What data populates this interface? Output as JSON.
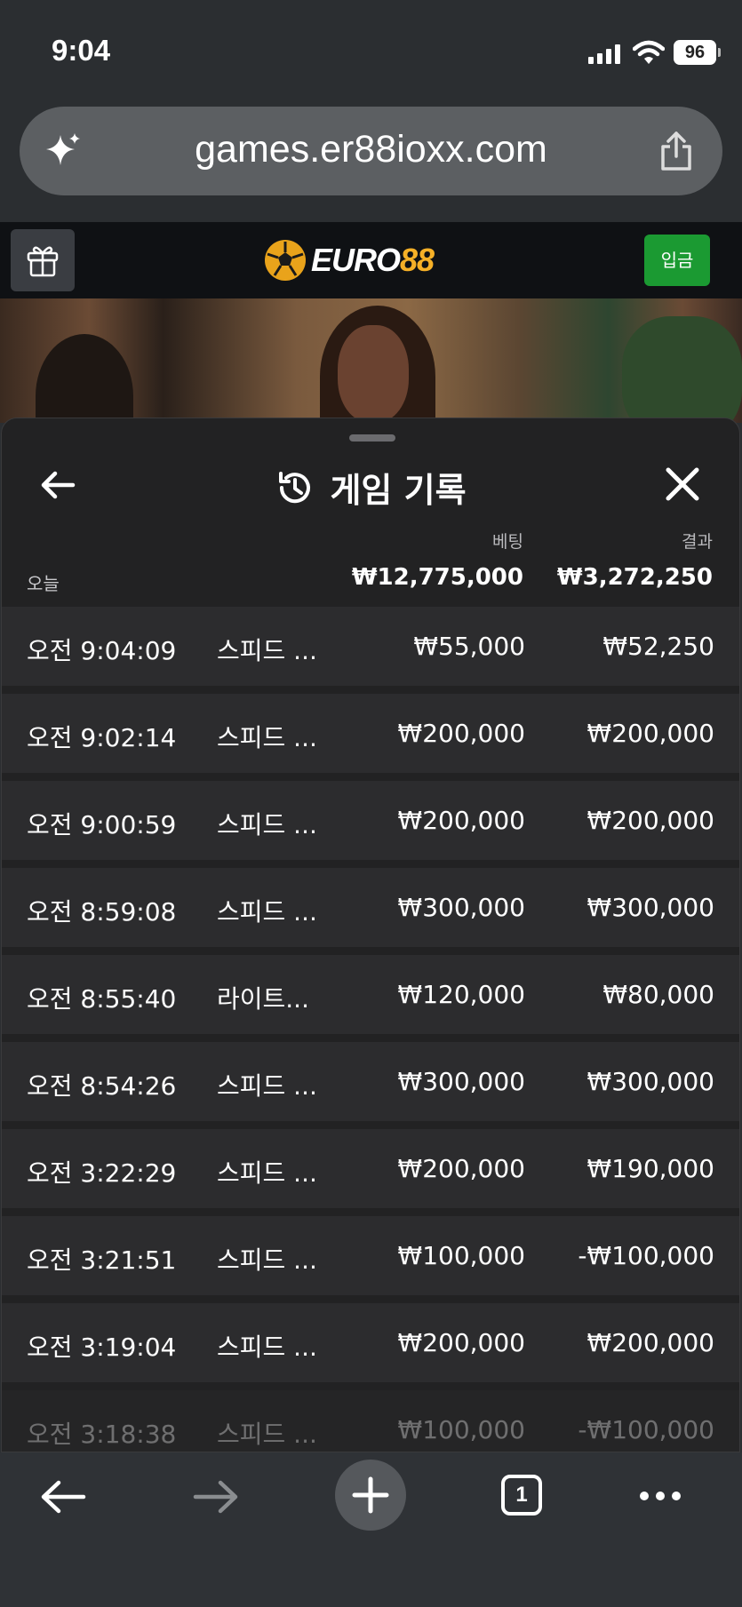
{
  "status_bar": {
    "time": "9:04",
    "battery": "96"
  },
  "browser": {
    "url": "games.er88ioxx.com",
    "tab_count": "1"
  },
  "site": {
    "logo_word": "EURO",
    "logo_num": "88",
    "deposit_label": "입금"
  },
  "sheet": {
    "title": "게임 기록",
    "bet_header": "베팅",
    "result_header": "결과",
    "today_label": "오늘",
    "total_bet": "₩12,775,000",
    "total_result": "₩3,272,250",
    "rows": [
      {
        "time": "오전 9:04:09",
        "game": "스피드 ...",
        "bet": "₩55,000",
        "result": "₩52,250"
      },
      {
        "time": "오전 9:02:14",
        "game": "스피드 ...",
        "bet": "₩200,000",
        "result": "₩200,000"
      },
      {
        "time": "오전 9:00:59",
        "game": "스피드 ...",
        "bet": "₩200,000",
        "result": "₩200,000"
      },
      {
        "time": "오전 8:59:08",
        "game": "스피드 ...",
        "bet": "₩300,000",
        "result": "₩300,000"
      },
      {
        "time": "오전 8:55:40",
        "game": "라이트...",
        "bet": "₩120,000",
        "result": "₩80,000"
      },
      {
        "time": "오전 8:54:26",
        "game": "스피드 ...",
        "bet": "₩300,000",
        "result": "₩300,000"
      },
      {
        "time": "오전 3:22:29",
        "game": "스피드 ...",
        "bet": "₩200,000",
        "result": "₩190,000"
      },
      {
        "time": "오전 3:21:51",
        "game": "스피드 ...",
        "bet": "₩100,000",
        "result": "-₩100,000"
      },
      {
        "time": "오전 3:19:04",
        "game": "스피드 ...",
        "bet": "₩200,000",
        "result": "₩200,000"
      },
      {
        "time": "오전 3:18:38",
        "game": "스피드 ...",
        "bet": "₩100,000",
        "result": "-₩100,000"
      }
    ]
  },
  "colors": {
    "deposit": "#1b9a32",
    "logo_gold": "#f5b027",
    "sheet_bg": "#222223",
    "row_bg": "#2c2c2e"
  }
}
